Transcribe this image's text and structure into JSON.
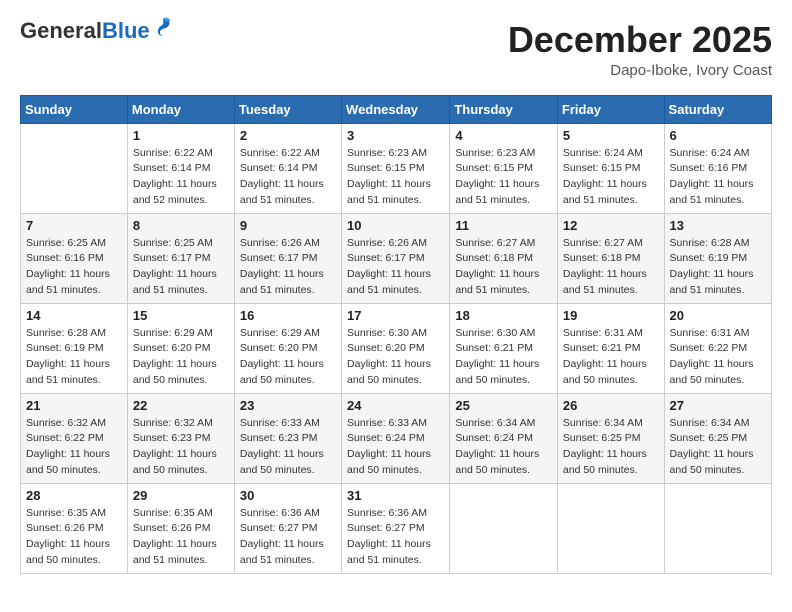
{
  "header": {
    "logo_general": "General",
    "logo_blue": "Blue",
    "month_title": "December 2025",
    "location": "Dapo-Iboke, Ivory Coast"
  },
  "calendar": {
    "days_of_week": [
      "Sunday",
      "Monday",
      "Tuesday",
      "Wednesday",
      "Thursday",
      "Friday",
      "Saturday"
    ],
    "weeks": [
      [
        {
          "day": "",
          "sunrise": "",
          "sunset": "",
          "daylight": ""
        },
        {
          "day": "1",
          "sunrise": "6:22 AM",
          "sunset": "6:14 PM",
          "daylight": "11 hours and 52 minutes."
        },
        {
          "day": "2",
          "sunrise": "6:22 AM",
          "sunset": "6:14 PM",
          "daylight": "11 hours and 51 minutes."
        },
        {
          "day": "3",
          "sunrise": "6:23 AM",
          "sunset": "6:15 PM",
          "daylight": "11 hours and 51 minutes."
        },
        {
          "day": "4",
          "sunrise": "6:23 AM",
          "sunset": "6:15 PM",
          "daylight": "11 hours and 51 minutes."
        },
        {
          "day": "5",
          "sunrise": "6:24 AM",
          "sunset": "6:15 PM",
          "daylight": "11 hours and 51 minutes."
        },
        {
          "day": "6",
          "sunrise": "6:24 AM",
          "sunset": "6:16 PM",
          "daylight": "11 hours and 51 minutes."
        }
      ],
      [
        {
          "day": "7",
          "sunrise": "6:25 AM",
          "sunset": "6:16 PM",
          "daylight": "11 hours and 51 minutes."
        },
        {
          "day": "8",
          "sunrise": "6:25 AM",
          "sunset": "6:17 PM",
          "daylight": "11 hours and 51 minutes."
        },
        {
          "day": "9",
          "sunrise": "6:26 AM",
          "sunset": "6:17 PM",
          "daylight": "11 hours and 51 minutes."
        },
        {
          "day": "10",
          "sunrise": "6:26 AM",
          "sunset": "6:17 PM",
          "daylight": "11 hours and 51 minutes."
        },
        {
          "day": "11",
          "sunrise": "6:27 AM",
          "sunset": "6:18 PM",
          "daylight": "11 hours and 51 minutes."
        },
        {
          "day": "12",
          "sunrise": "6:27 AM",
          "sunset": "6:18 PM",
          "daylight": "11 hours and 51 minutes."
        },
        {
          "day": "13",
          "sunrise": "6:28 AM",
          "sunset": "6:19 PM",
          "daylight": "11 hours and 51 minutes."
        }
      ],
      [
        {
          "day": "14",
          "sunrise": "6:28 AM",
          "sunset": "6:19 PM",
          "daylight": "11 hours and 51 minutes."
        },
        {
          "day": "15",
          "sunrise": "6:29 AM",
          "sunset": "6:20 PM",
          "daylight": "11 hours and 50 minutes."
        },
        {
          "day": "16",
          "sunrise": "6:29 AM",
          "sunset": "6:20 PM",
          "daylight": "11 hours and 50 minutes."
        },
        {
          "day": "17",
          "sunrise": "6:30 AM",
          "sunset": "6:20 PM",
          "daylight": "11 hours and 50 minutes."
        },
        {
          "day": "18",
          "sunrise": "6:30 AM",
          "sunset": "6:21 PM",
          "daylight": "11 hours and 50 minutes."
        },
        {
          "day": "19",
          "sunrise": "6:31 AM",
          "sunset": "6:21 PM",
          "daylight": "11 hours and 50 minutes."
        },
        {
          "day": "20",
          "sunrise": "6:31 AM",
          "sunset": "6:22 PM",
          "daylight": "11 hours and 50 minutes."
        }
      ],
      [
        {
          "day": "21",
          "sunrise": "6:32 AM",
          "sunset": "6:22 PM",
          "daylight": "11 hours and 50 minutes."
        },
        {
          "day": "22",
          "sunrise": "6:32 AM",
          "sunset": "6:23 PM",
          "daylight": "11 hours and 50 minutes."
        },
        {
          "day": "23",
          "sunrise": "6:33 AM",
          "sunset": "6:23 PM",
          "daylight": "11 hours and 50 minutes."
        },
        {
          "day": "24",
          "sunrise": "6:33 AM",
          "sunset": "6:24 PM",
          "daylight": "11 hours and 50 minutes."
        },
        {
          "day": "25",
          "sunrise": "6:34 AM",
          "sunset": "6:24 PM",
          "daylight": "11 hours and 50 minutes."
        },
        {
          "day": "26",
          "sunrise": "6:34 AM",
          "sunset": "6:25 PM",
          "daylight": "11 hours and 50 minutes."
        },
        {
          "day": "27",
          "sunrise": "6:34 AM",
          "sunset": "6:25 PM",
          "daylight": "11 hours and 50 minutes."
        }
      ],
      [
        {
          "day": "28",
          "sunrise": "6:35 AM",
          "sunset": "6:26 PM",
          "daylight": "11 hours and 50 minutes."
        },
        {
          "day": "29",
          "sunrise": "6:35 AM",
          "sunset": "6:26 PM",
          "daylight": "11 hours and 51 minutes."
        },
        {
          "day": "30",
          "sunrise": "6:36 AM",
          "sunset": "6:27 PM",
          "daylight": "11 hours and 51 minutes."
        },
        {
          "day": "31",
          "sunrise": "6:36 AM",
          "sunset": "6:27 PM",
          "daylight": "11 hours and 51 minutes."
        },
        {
          "day": "",
          "sunrise": "",
          "sunset": "",
          "daylight": ""
        },
        {
          "day": "",
          "sunrise": "",
          "sunset": "",
          "daylight": ""
        },
        {
          "day": "",
          "sunrise": "",
          "sunset": "",
          "daylight": ""
        }
      ]
    ]
  }
}
